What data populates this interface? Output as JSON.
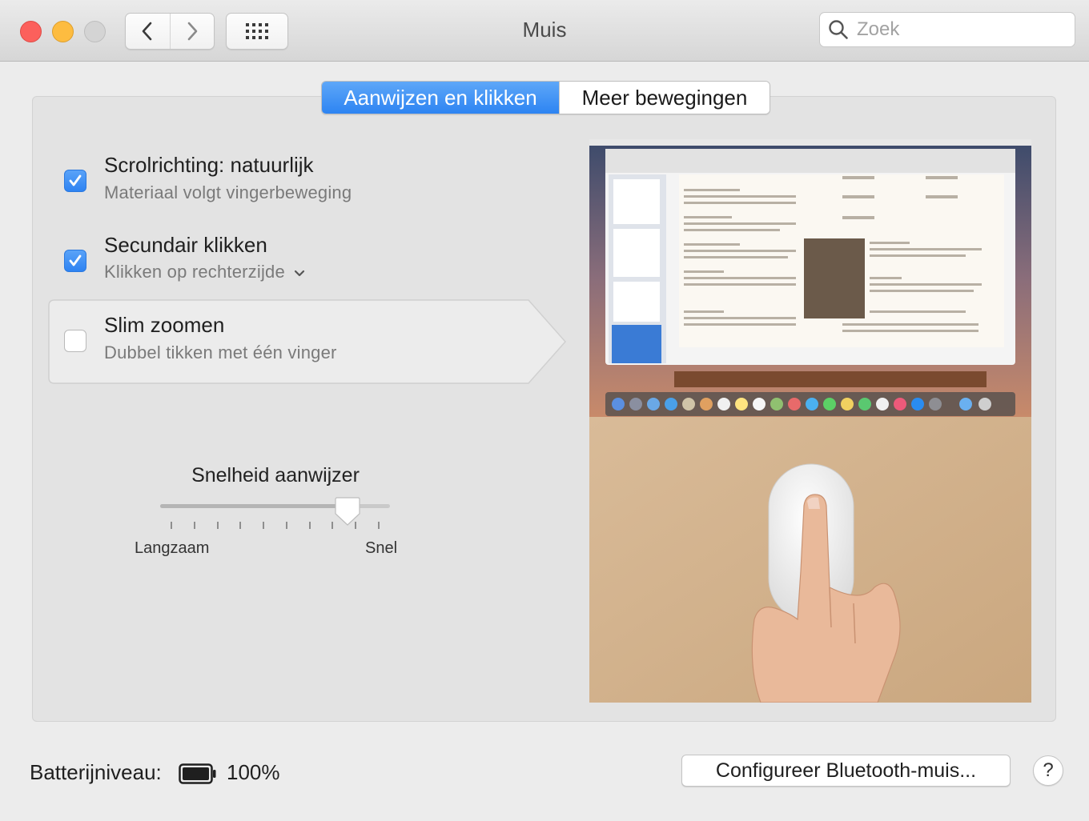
{
  "window": {
    "title": "Muis"
  },
  "toolbar": {
    "back_icon": "chevron-left-icon",
    "forward_icon": "chevron-right-icon",
    "grid_icon": "show-all-grid-icon"
  },
  "search": {
    "placeholder": "Zoek",
    "value": ""
  },
  "tabs": [
    {
      "label": "Aanwijzen en klikken",
      "active": true
    },
    {
      "label": "Meer bewegingen",
      "active": false
    }
  ],
  "options": [
    {
      "title": "Scrolrichting: natuurlijk",
      "subtitle": "Materiaal volgt vingerbeweging",
      "checked": true
    },
    {
      "title": "Secundair klikken",
      "subtitle": "Klikken op rechterzijde",
      "checked": true,
      "has_dropdown": true
    },
    {
      "title": "Slim zoomen",
      "subtitle": "Dubbel tikken met één vinger",
      "checked": false,
      "selected": true
    }
  ],
  "tracking_speed": {
    "label": "Snelheid aanwijzer",
    "min_label": "Langzaam",
    "max_label": "Snel",
    "value_fraction": 0.85,
    "tick_count": 10
  },
  "footer": {
    "battery_label": "Batterijniveau:",
    "battery_value": "100%",
    "battery_fraction": 1.0,
    "config_button": "Configureer Bluetooth-muis...",
    "help_button": "?"
  },
  "colors": {
    "accent": "#2e83f2",
    "close": "#fc605c",
    "minimize": "#fdbc40",
    "maximize_disabled": "#d4d4d4"
  }
}
